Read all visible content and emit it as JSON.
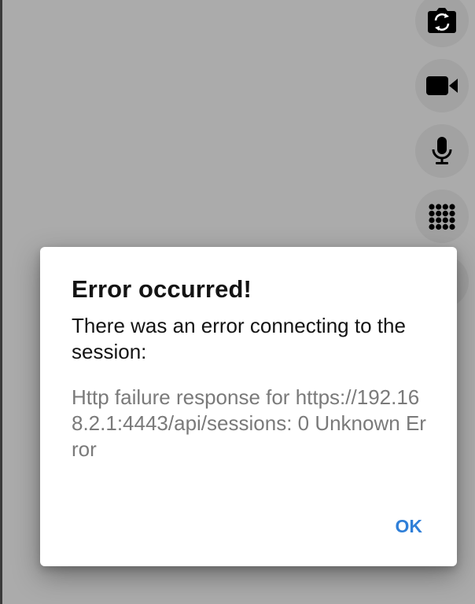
{
  "side_controls": {
    "items": [
      {
        "icon": "flip-camera-icon"
      },
      {
        "icon": "video-camera-icon"
      },
      {
        "icon": "microphone-icon"
      },
      {
        "icon": "dialpad-icon"
      },
      {
        "icon": "more-control-icon"
      }
    ]
  },
  "dialog": {
    "title": "Error occurred!",
    "message": "There was an error connecting to the session:",
    "detail": "Http failure response for https://192.168.2.1:4443/api/sessions: 0 Unknown Error",
    "ok_label": "OK"
  },
  "colors": {
    "backdrop": "#ababab",
    "dialog_background": "#ffffff",
    "accent": "#2f7fd8",
    "detail_text": "#7a7a7a"
  }
}
